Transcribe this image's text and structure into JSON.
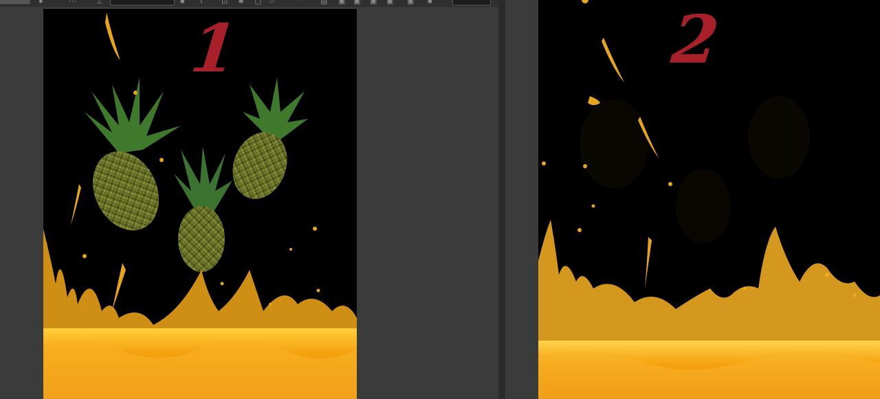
{
  "toolbar": {
    "icons": [
      "circle-icon",
      "more-icon",
      "tool-icon",
      "square-icon",
      "path-icon",
      "transform-icon",
      "circle-icon",
      "frame-icon",
      "save-icon",
      "layers-icon",
      "layers-icon",
      "layers-icon",
      "layers-icon",
      "stop-icon"
    ]
  },
  "renders": [
    {
      "label": "1",
      "description_tag": "with-pineapples"
    },
    {
      "label": "2",
      "description_tag": "without-pineapples"
    }
  ],
  "colors": {
    "label": "#a8202a",
    "juice": "#f5a20f",
    "juice_light": "#ffd24a",
    "background": "#000000",
    "panel": "#3b3b3b"
  }
}
